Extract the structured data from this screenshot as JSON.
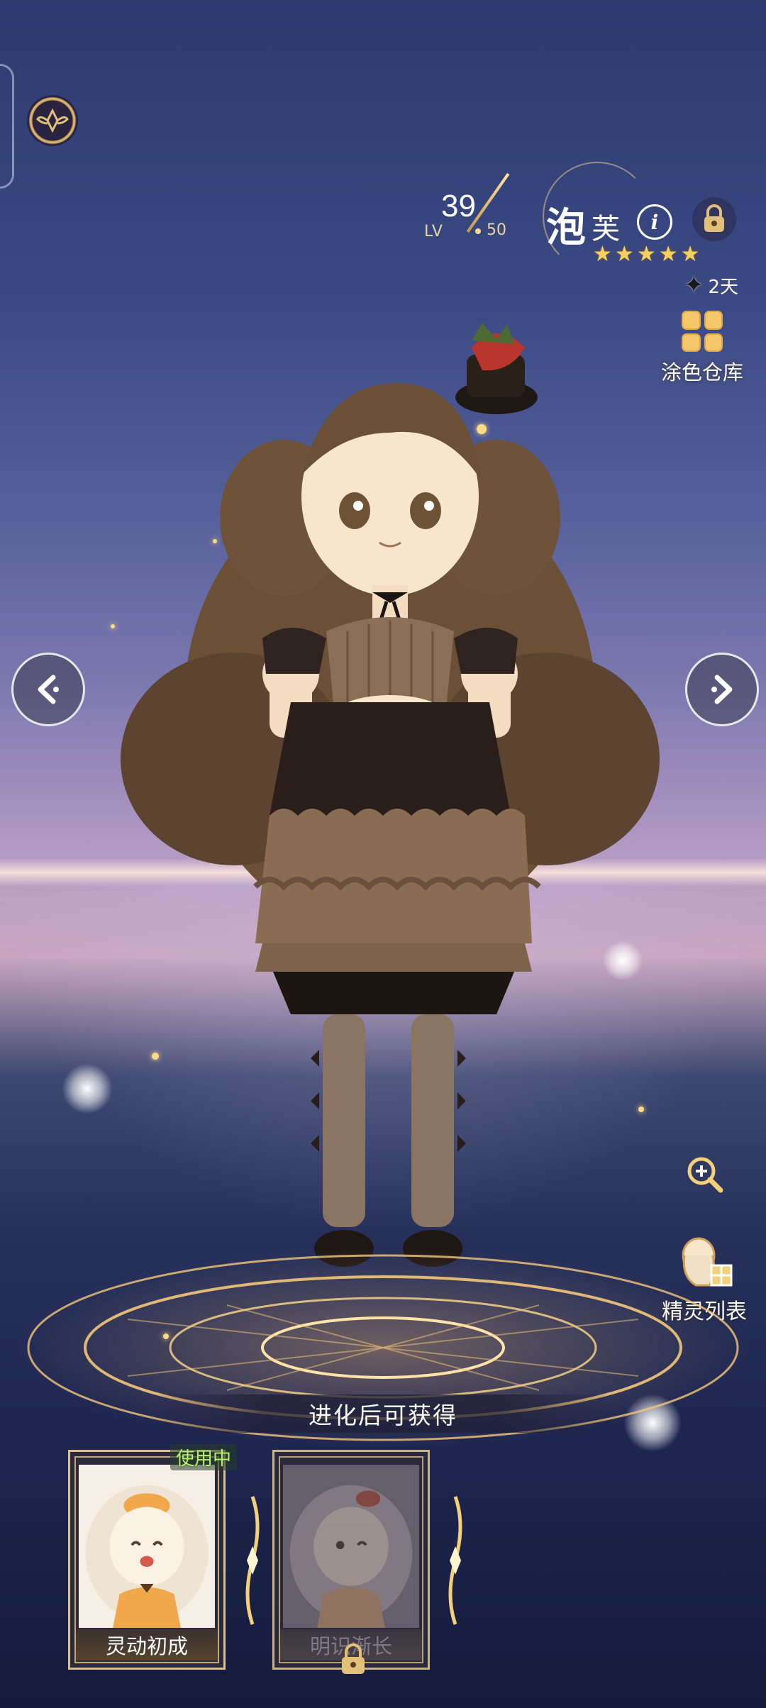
{
  "character": {
    "level_prefix": "LV",
    "level": "39",
    "level_max": "50",
    "name_main": "泡",
    "name_sub": "芙",
    "info_glyph": "i",
    "star_count": 5,
    "star_glyph": "★",
    "days_left": "2天"
  },
  "menu": {
    "paint_storage_label": "涂色仓库",
    "sprite_list_label": "精灵列表"
  },
  "evolve_hint": "进化后可获得",
  "forms": [
    {
      "label": "灵动初成",
      "status": "使用中",
      "locked": false
    },
    {
      "label": "明识渐长",
      "locked": true
    }
  ],
  "colors": {
    "accent_gold": "#e3c07a",
    "star_gold": "#f6cf62",
    "active_green": "#b7f07a"
  },
  "icons": {
    "top_left": "winged-emblem-icon",
    "nav_left": "chevron-left-icon",
    "nav_right": "chevron-right-icon",
    "zoom": "zoom-in-icon",
    "lock": "lock-icon",
    "days": "sparkle-icon"
  }
}
